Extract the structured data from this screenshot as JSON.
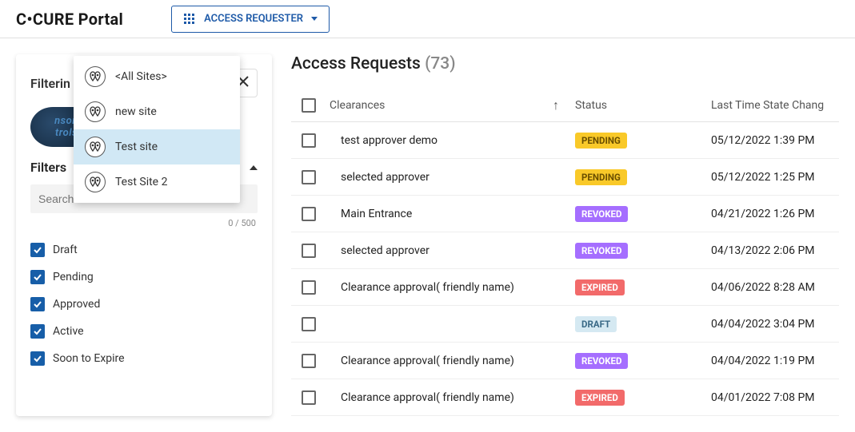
{
  "header": {
    "portal_title": "C•CURE Portal",
    "role_label": "ACCESS REQUESTER"
  },
  "site_popover": {
    "items": [
      {
        "label": "<All Sites>",
        "selected": false
      },
      {
        "label": "new site",
        "selected": false
      },
      {
        "label": "Test site",
        "selected": true
      },
      {
        "label": "Test Site 2",
        "selected": false
      }
    ]
  },
  "sidebar": {
    "filtering_label": "Filterin",
    "brand_text": "nson\ntrols",
    "filters_label": "Filters",
    "search_placeholder": "Search",
    "search_counter": "0 / 500",
    "filters": [
      {
        "label": "Draft",
        "checked": true
      },
      {
        "label": "Pending",
        "checked": true
      },
      {
        "label": "Approved",
        "checked": true
      },
      {
        "label": "Active",
        "checked": true
      },
      {
        "label": "Soon to Expire",
        "checked": true
      }
    ]
  },
  "main": {
    "title": "Access Requests",
    "count": "(73)",
    "columns": {
      "clearances": "Clearances",
      "status": "Status",
      "last_time": "Last Time State Chang"
    },
    "rows": [
      {
        "clearance": "test approver demo",
        "status": "PENDING",
        "time": "05/12/2022 1:39 PM"
      },
      {
        "clearance": "selected approver",
        "status": "PENDING",
        "time": "05/12/2022 1:25 PM"
      },
      {
        "clearance": "Main Entrance",
        "status": "REVOKED",
        "time": "04/21/2022 1:26 PM"
      },
      {
        "clearance": "selected approver",
        "status": "REVOKED",
        "time": "04/13/2022 2:06 PM"
      },
      {
        "clearance": "Clearance approval( friendly name)",
        "status": "EXPIRED",
        "time": "04/06/2022 8:28 AM"
      },
      {
        "clearance": "",
        "status": "DRAFT",
        "time": "04/04/2022 3:04 PM"
      },
      {
        "clearance": "Clearance approval( friendly name)",
        "status": "REVOKED",
        "time": "04/04/2022 1:19 PM"
      },
      {
        "clearance": "Clearance approval( friendly name)",
        "status": "EXPIRED",
        "time": "04/01/2022 7:08 PM"
      }
    ]
  }
}
